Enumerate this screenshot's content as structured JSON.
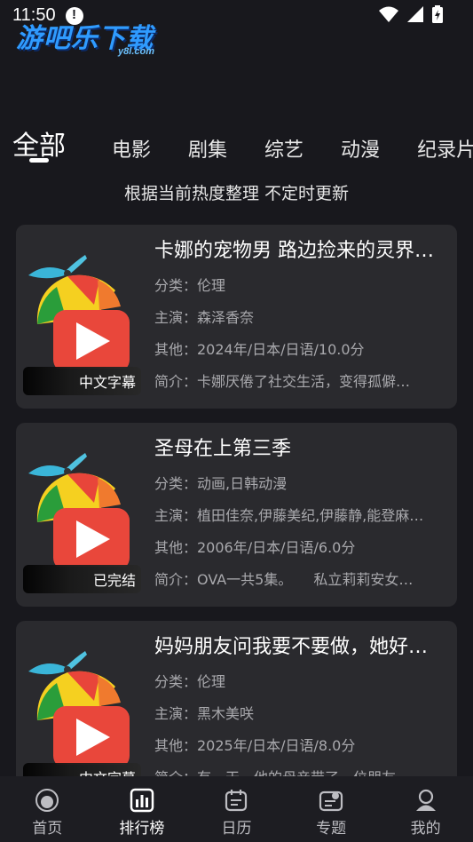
{
  "status": {
    "time": "11:50"
  },
  "logo": {
    "text": "游吧乐下载",
    "sub": "y8l.com"
  },
  "tabs": [
    {
      "label": "全部",
      "active": true
    },
    {
      "label": "电影"
    },
    {
      "label": "剧集"
    },
    {
      "label": "综艺"
    },
    {
      "label": "动漫"
    },
    {
      "label": "纪录片"
    }
  ],
  "subtitle": "根据当前热度整理 不定时更新",
  "items": [
    {
      "title": "卡娜的宠物男 路边捡来的灵界…",
      "category": "分类：伦理",
      "cast": "主演：森泽香奈",
      "other": "其他：2024年/日本/日语/10.0分",
      "summary": "简介：卡娜厌倦了社交生活，变得孤僻…",
      "badge": "中文字幕"
    },
    {
      "title": "圣母在上第三季",
      "category": "分类：动画,日韩动漫",
      "cast": "主演：植田佳奈,伊藤美纪,伊藤静,能登麻…",
      "other": "其他：2006年/日本/日语/6.0分",
      "summary": "简介：OVA一共5集。　　私立莉莉安女…",
      "badge": "已完结"
    },
    {
      "title": "妈妈朋友问我要不要做，她好…",
      "category": "分类：伦理",
      "cast": "主演：黑木美咲",
      "other": "其他：2025年/日本/日语/8.0分",
      "summary": "简介：有一天，他的母亲带了一位朋友…",
      "badge": "中文字幕"
    }
  ],
  "nav": [
    {
      "label": "首页",
      "icon": "home-icon"
    },
    {
      "label": "排行榜",
      "icon": "ranking-icon",
      "active": true
    },
    {
      "label": "日历",
      "icon": "calendar-icon"
    },
    {
      "label": "专题",
      "icon": "topic-icon"
    },
    {
      "label": "我的",
      "icon": "profile-icon"
    }
  ]
}
